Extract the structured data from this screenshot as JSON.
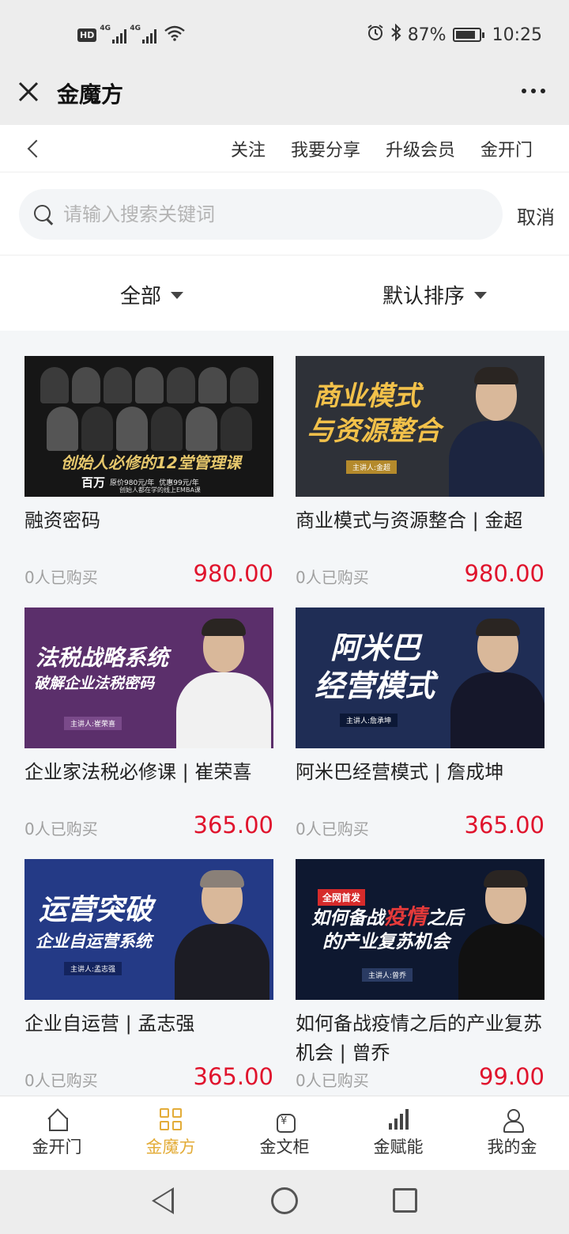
{
  "status_bar": {
    "hd_label": "HD",
    "network_1": "4G",
    "network_2": "4G",
    "battery_percent": "87%",
    "battery_level": 0.87,
    "time": "10:25"
  },
  "title_bar": {
    "title": "金魔方"
  },
  "sub_nav": {
    "links": [
      "关注",
      "我要分享",
      "升级会员",
      "金开门"
    ]
  },
  "search": {
    "placeholder": "请输入搜索关键词",
    "value": "",
    "cancel_label": "取消"
  },
  "filters": {
    "category": "全部",
    "sort": "默认排序"
  },
  "courses": [
    {
      "title": "融资密码",
      "buyers": "0人已购买",
      "price": "980.00",
      "thumb": {
        "headline": "创始人必修的12堂管理课",
        "subline": "百万",
        "small_1": "原价980元/年",
        "small_2": "优惠99元/年",
        "small_3": "创始人都在学的线上EMBA课"
      }
    },
    {
      "title": "商业模式与资源整合 | 金超",
      "buyers": "0人已购买",
      "price": "980.00",
      "thumb": {
        "headline_1": "商业模式",
        "headline_2": "与资源整合",
        "speaker": "主讲人:金超"
      }
    },
    {
      "title": "企业家法税必修课 | 崔荣喜",
      "buyers": "0人已购买",
      "price": "365.00",
      "thumb": {
        "headline_1": "法税战略系统",
        "headline_2": "破解企业法税密码",
        "speaker": "主讲人:崔荣喜"
      }
    },
    {
      "title": "阿米巴经营模式 | 詹成坤",
      "buyers": "0人已购买",
      "price": "365.00",
      "thumb": {
        "headline_1": "阿米巴",
        "headline_2": "经营模式",
        "speaker": "主讲人:詹承坤"
      }
    },
    {
      "title": "企业自运营 | 孟志强",
      "buyers": "0人已购买",
      "price": "365.00",
      "thumb": {
        "headline_1": "运营突破",
        "headline_2": "企业自运营系统",
        "speaker": "主讲人:孟志强"
      }
    },
    {
      "title": "如何备战疫情之后的产业复苏机会 | 曾乔",
      "buyers": "0人已购买",
      "price": "99.00",
      "thumb": {
        "badge": "全网首发",
        "headline_1a": "如何备战",
        "headline_1b": "疫情",
        "headline_1c": "之后",
        "headline_2": "的产业复苏机会",
        "speaker": "主讲人:曾乔"
      }
    }
  ],
  "tab_bar": {
    "tabs": [
      {
        "label": "金开门",
        "icon": "home-icon"
      },
      {
        "label": "金魔方",
        "icon": "grid-icon"
      },
      {
        "label": "金文柜",
        "icon": "money-bag-icon"
      },
      {
        "label": "金赋能",
        "icon": "bar-chart-icon"
      },
      {
        "label": "我的金",
        "icon": "user-icon"
      }
    ],
    "active_index": 1,
    "active_color": "#e3ac38"
  },
  "colors": {
    "price": "#e0142d",
    "background": "#f4f6f8"
  }
}
